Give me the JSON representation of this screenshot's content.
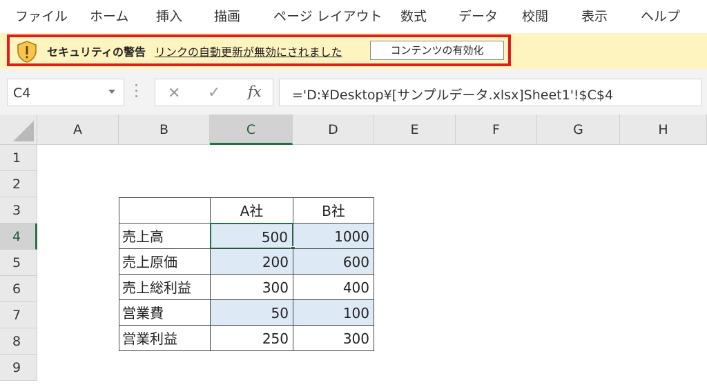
{
  "ribbon": {
    "tabs": [
      "ファイル",
      "ホーム",
      "挿入",
      "描画",
      "ページ レイアウト",
      "数式",
      "データ",
      "校閲",
      "表示",
      "ヘルプ"
    ]
  },
  "security_bar": {
    "title": "セキュリティの警告",
    "message": "リンクの自動更新が無効にされました",
    "button_label": "コンテンツの有効化",
    "icon": "shield-warning-icon",
    "highlight_color": "#e21b1b",
    "background_color": "#fdf4c0"
  },
  "formula_bar": {
    "name_box": "C4",
    "cancel_symbol": "✕",
    "enter_symbol": "✓",
    "fx_label": "fx",
    "formula": "='D:¥Desktop¥[サンプルデータ.xlsx]Sheet1'!$C$4"
  },
  "sheet": {
    "columns": [
      "A",
      "B",
      "C",
      "D",
      "E",
      "F",
      "G",
      "H"
    ],
    "rows": [
      "1",
      "2",
      "3",
      "4",
      "5",
      "6",
      "7",
      "8",
      "9"
    ],
    "selected_column": "C",
    "selected_row": "4",
    "table": {
      "header": [
        "",
        "A社",
        "B社"
      ],
      "rows": [
        [
          "売上高",
          "500",
          "1000"
        ],
        [
          "売上原価",
          "200",
          "600"
        ],
        [
          "売上総利益",
          "300",
          "400"
        ],
        [
          "営業費",
          "50",
          "100"
        ],
        [
          "営業利益",
          "250",
          "300"
        ]
      ]
    },
    "highlight_color": "#dde9f4",
    "selection_color": "#217346"
  }
}
